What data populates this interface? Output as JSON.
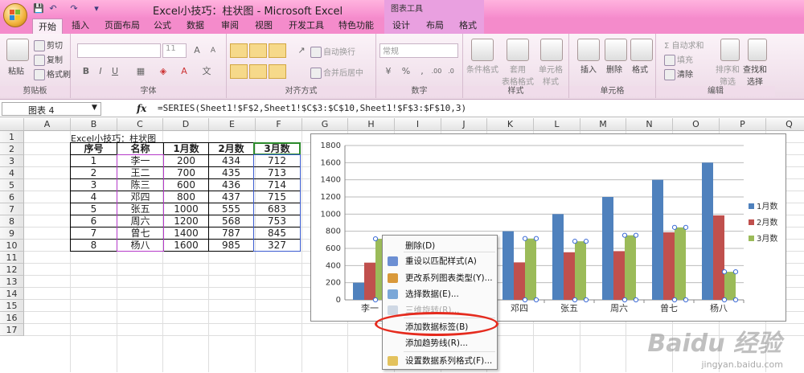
{
  "window": {
    "title": "Excel小技巧：柱状图 - Microsoft Excel",
    "context_tools": "图表工具"
  },
  "tabs": [
    "开始",
    "插入",
    "页面布局",
    "公式",
    "数据",
    "审阅",
    "视图",
    "开发工具",
    "特色功能",
    "设计",
    "布局",
    "格式"
  ],
  "ribbon": {
    "clipboard": {
      "label": "剪贴板",
      "paste": "粘贴",
      "cut": "剪切",
      "copy": "复制",
      "format_painter": "格式刷"
    },
    "font": {
      "label": "字体",
      "size": "11"
    },
    "align": {
      "label": "对齐方式",
      "wrap": "自动换行",
      "merge": "合并后居中"
    },
    "number": {
      "label": "数字",
      "format": "常规"
    },
    "styles": {
      "label": "样式",
      "cond": "条件格式",
      "table": "套用\n表格格式",
      "cell": "单元格\n样式"
    },
    "cells": {
      "label": "单元格",
      "insert": "插入",
      "delete": "删除",
      "format": "格式"
    },
    "edit": {
      "label": "编辑",
      "autosum": "自动求和",
      "fill": "填充",
      "clear": "清除",
      "sort": "排序和\n筛选",
      "find": "查找和\n选择"
    }
  },
  "formula_bar": {
    "name_box": "图表 4",
    "formula": "=SERIES(Sheet1!$F$2,Sheet1!$C$3:$C$10,Sheet1!$F$3:$F$10,3)"
  },
  "columns": [
    "A",
    "B",
    "C",
    "D",
    "E",
    "F",
    "G",
    "H",
    "I",
    "J",
    "K",
    "L",
    "M",
    "N",
    "O",
    "P",
    "Q"
  ],
  "rows": [
    "1",
    "2",
    "3",
    "4",
    "5",
    "6",
    "7",
    "8",
    "9",
    "10",
    "11",
    "12",
    "13",
    "14",
    "15",
    "16",
    "17"
  ],
  "sheet": {
    "b1": "Excel小技巧：柱状图",
    "headers": [
      "序号",
      "名称",
      "1月数",
      "2月数",
      "3月数"
    ],
    "data": [
      [
        "1",
        "李一",
        "200",
        "434",
        "712"
      ],
      [
        "2",
        "王二",
        "700",
        "435",
        "713"
      ],
      [
        "3",
        "陈三",
        "600",
        "436",
        "714"
      ],
      [
        "4",
        "邓四",
        "800",
        "437",
        "715"
      ],
      [
        "5",
        "张五",
        "1000",
        "555",
        "683"
      ],
      [
        "6",
        "周六",
        "1200",
        "568",
        "753"
      ],
      [
        "7",
        "曾七",
        "1400",
        "787",
        "845"
      ],
      [
        "8",
        "杨八",
        "1600",
        "985",
        "327"
      ]
    ]
  },
  "chart_data": {
    "type": "bar",
    "categories": [
      "李一",
      "王二",
      "陈三",
      "邓四",
      "张五",
      "周六",
      "曾七",
      "杨八"
    ],
    "series": [
      {
        "name": "1月数",
        "values": [
          200,
          700,
          600,
          800,
          1000,
          1200,
          1400,
          1600
        ],
        "color": "#4f81bd"
      },
      {
        "name": "2月数",
        "values": [
          434,
          435,
          436,
          437,
          555,
          568,
          787,
          985
        ],
        "color": "#c0504d"
      },
      {
        "name": "3月数",
        "values": [
          712,
          713,
          714,
          715,
          683,
          753,
          845,
          327
        ],
        "color": "#9bbb59"
      }
    ],
    "ylim": [
      0,
      1800
    ],
    "yticks": [
      "0",
      "200",
      "400",
      "600",
      "800",
      "1000",
      "1200",
      "1400",
      "1600",
      "1800"
    ],
    "grid": true,
    "legend": "right",
    "selected_series": "3月数"
  },
  "context_menu": {
    "items": [
      {
        "label": "删除(D)",
        "icon": "none",
        "disabled": false
      },
      {
        "label": "重设以匹配样式(A)",
        "icon": "reset-icon",
        "disabled": false
      },
      {
        "label": "更改系列图表类型(Y)...",
        "icon": "chart-type-icon",
        "disabled": false
      },
      {
        "label": "选择数据(E)...",
        "icon": "select-data-icon",
        "disabled": false
      },
      {
        "label": "三维旋转(R)...",
        "icon": "rotate-3d-icon",
        "disabled": true
      },
      {
        "label": "添加数据标签(B)",
        "icon": "none",
        "disabled": false
      },
      {
        "label": "添加趋势线(R)...",
        "icon": "none",
        "disabled": false
      },
      {
        "label": "设置数据系列格式(F)...",
        "icon": "format-series-icon",
        "disabled": false
      }
    ]
  },
  "watermark": {
    "text": "Baidu 经验",
    "url": "jingyan.baidu.com"
  }
}
